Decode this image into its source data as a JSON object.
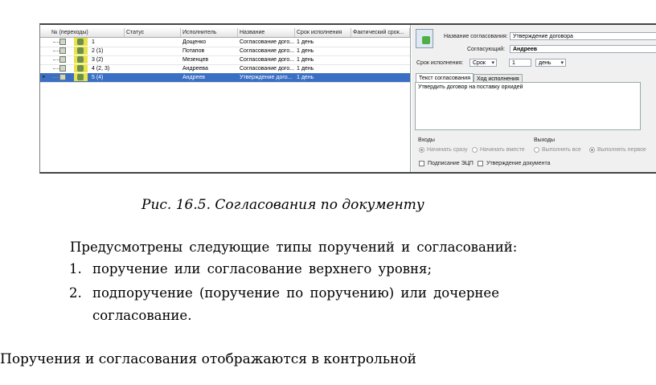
{
  "grid": {
    "headers": [
      "№ (переходы)",
      "Статус",
      "Исполнитель",
      "Название",
      "Срок исполнения",
      "Фактический срок..."
    ],
    "rows": [
      {
        "num": "1",
        "status": "",
        "executor": "Дощенко",
        "name": "Согласование дого...",
        "term": "1 день",
        "actual": ""
      },
      {
        "num": "2 (1)",
        "status": "",
        "executor": "Потапов",
        "name": "Согласование дого...",
        "term": "1 день",
        "actual": ""
      },
      {
        "num": "3 (2)",
        "status": "",
        "executor": "Мезенцев",
        "name": "Согласование дого...",
        "term": "1 день",
        "actual": ""
      },
      {
        "num": "4 (2, 3)",
        "status": "",
        "executor": "Андреева",
        "name": "Согласование дого...",
        "term": "1 день",
        "actual": ""
      },
      {
        "num": "5 (4)",
        "status": "",
        "executor": "Андреев",
        "name": "Утверждение дого...",
        "term": "1 день",
        "actual": ""
      }
    ],
    "selected_row_marker": "►"
  },
  "detail": {
    "name_label": "Название согласования:",
    "name_value": "Утверждение договора",
    "approver_label": "Согласующий:",
    "approver_value": "Андреев",
    "term_label": "Срок исполнения:",
    "term_type": "Срок",
    "term_count": "1",
    "term_unit": "день",
    "tab_text": "Текст согласования",
    "tab_history": "Ход исполнения",
    "text_value": "Утвердить договор на поставку орхидей",
    "inputs_label": "Входы",
    "outputs_label": "Выходы",
    "input_opt1": "Начинать сразу",
    "input_opt2": "Начинать вместе",
    "output_opt1": "Выполнять все",
    "output_opt2": "Выполнять первое",
    "check_esp": "Подписание ЭЦП",
    "check_approve": "Утверждение документа"
  },
  "caption": "Рис. 16.5. Согласования по документу",
  "para_intro": "Предусмотрены следующие типы поручений и согласований:",
  "list": [
    {
      "n": "1.",
      "text": "поручение или согласование верхнего уровня;"
    },
    {
      "n": "2.",
      "text": "подпоручение (поручение по поручению) или дочернее"
    },
    {
      "n": "",
      "text": "согласование."
    }
  ],
  "para_last": "Поручения и согласования отображаются в контрольной"
}
